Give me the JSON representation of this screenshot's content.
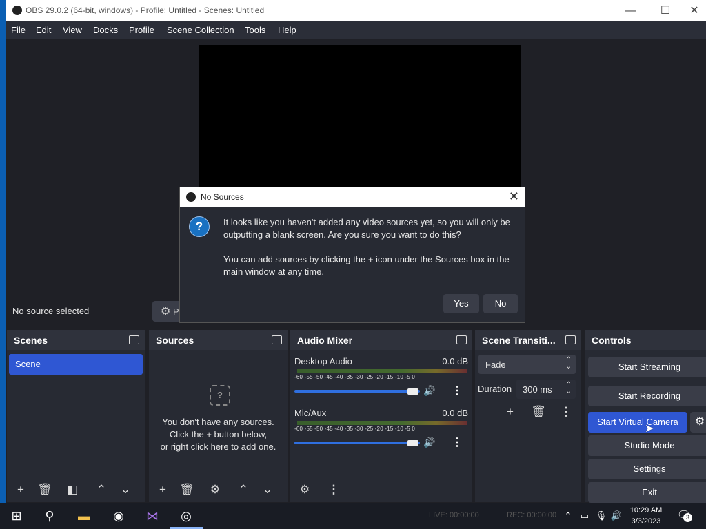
{
  "window": {
    "title": "OBS 29.0.2 (64-bit, windows) - Profile: Untitled - Scenes: Untitled",
    "minimize": "—",
    "maximize": "☐",
    "close": "✕"
  },
  "menu": [
    "File",
    "Edit",
    "View",
    "Docks",
    "Profile",
    "Scene Collection",
    "Tools",
    "Help"
  ],
  "status": {
    "no_source": "No source selected",
    "properties_label": "Pr"
  },
  "scenes": {
    "title": "Scenes",
    "items": [
      "Scene"
    ]
  },
  "sources": {
    "title": "Sources",
    "empty_line1": "You don't have any sources.",
    "empty_line2": "Click the + button below,",
    "empty_line3": "or right click here to add one."
  },
  "mixer": {
    "title": "Audio Mixer",
    "channels": [
      {
        "name": "Desktop Audio",
        "db": "0.0 dB",
        "scale": "-60 -55 -50 -45 -40 -35 -30 -25 -20 -15 -10 -5 0"
      },
      {
        "name": "Mic/Aux",
        "db": "0.0 dB",
        "scale": "-60 -55 -50 -45 -40 -35 -30 -25 -20 -15 -10 -5 0"
      }
    ]
  },
  "transitions": {
    "title": "Scene Transiti...",
    "selected": "Fade",
    "duration_label": "Duration",
    "duration_value": "300 ms"
  },
  "controls": {
    "title": "Controls",
    "start_streaming": "Start Streaming",
    "start_recording": "Start Recording",
    "start_virtual_camera": "Start Virtual Camera",
    "studio_mode": "Studio Mode",
    "settings": "Settings",
    "exit": "Exit"
  },
  "dialog": {
    "title": "No Sources",
    "message1": "It looks like you haven't added any video sources yet, so you will only be outputting a blank screen. Are you sure you want to do this?",
    "message2": "You can add sources by clicking the + icon under the Sources box in the main window at any time.",
    "yes": "Yes",
    "no": "No"
  },
  "taskbar": {
    "live": "LIVE: 00:00:00",
    "rec": "REC: 00:00:00",
    "time": "10:29 AM",
    "date": "3/3/2023",
    "notifications": "3"
  },
  "colors": {
    "accent": "#2f57d3",
    "panel": "#272a33",
    "background": "#1f2026",
    "dialog_icon": "#1971c2"
  }
}
